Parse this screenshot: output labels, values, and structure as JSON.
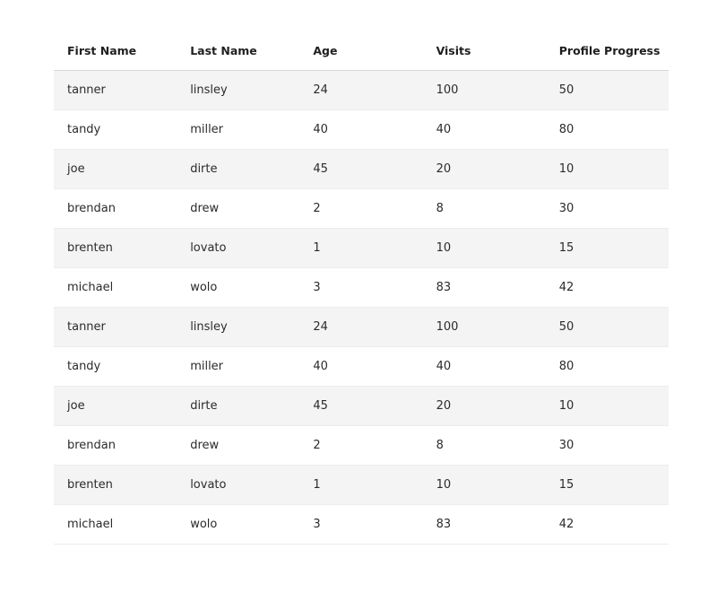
{
  "table": {
    "columns": [
      "First Name",
      "Last Name",
      "Age",
      "Visits",
      "Profile Progress"
    ],
    "rows": [
      [
        "tanner",
        "linsley",
        "24",
        "100",
        "50"
      ],
      [
        "tandy",
        "miller",
        "40",
        "40",
        "80"
      ],
      [
        "joe",
        "dirte",
        "45",
        "20",
        "10"
      ],
      [
        "brendan",
        "drew",
        "2",
        "8",
        "30"
      ],
      [
        "brenten",
        "lovato",
        "1",
        "10",
        "15"
      ],
      [
        "michael",
        "wolo",
        "3",
        "83",
        "42"
      ],
      [
        "tanner",
        "linsley",
        "24",
        "100",
        "50"
      ],
      [
        "tandy",
        "miller",
        "40",
        "40",
        "80"
      ],
      [
        "joe",
        "dirte",
        "45",
        "20",
        "10"
      ],
      [
        "brendan",
        "drew",
        "2",
        "8",
        "30"
      ],
      [
        "brenten",
        "lovato",
        "1",
        "10",
        "15"
      ],
      [
        "michael",
        "wolo",
        "3",
        "83",
        "42"
      ]
    ]
  },
  "colors": {
    "row_stripe": "#f4f4f4",
    "header_border": "#d6d6d6",
    "row_border": "#ececec",
    "text": "#1f1f1f"
  }
}
